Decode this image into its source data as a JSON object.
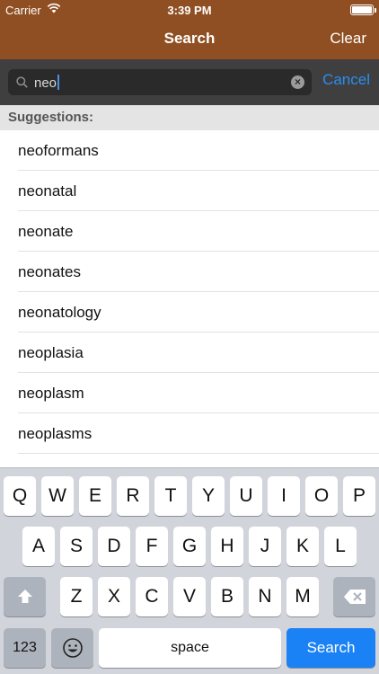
{
  "status_bar": {
    "carrier": "Carrier",
    "time": "3:39 PM"
  },
  "nav": {
    "title": "Search",
    "clear_label": "Clear"
  },
  "search": {
    "value": "neo",
    "cancel_label": "Cancel"
  },
  "suggestions": {
    "header": "Suggestions:",
    "items": [
      "neoformans",
      "neonatal",
      "neonate",
      "neonates",
      "neonatology",
      "neoplasia",
      "neoplasm",
      "neoplasms"
    ]
  },
  "keyboard": {
    "row1": [
      "Q",
      "W",
      "E",
      "R",
      "T",
      "Y",
      "U",
      "I",
      "O",
      "P"
    ],
    "row2": [
      "A",
      "S",
      "D",
      "F",
      "G",
      "H",
      "J",
      "K",
      "L"
    ],
    "row3": [
      "Z",
      "X",
      "C",
      "V",
      "B",
      "N",
      "M"
    ],
    "numbers_label": "123",
    "space_label": "space",
    "search_label": "Search"
  },
  "colors": {
    "nav_bar": "#8f4f22",
    "accent": "#2b8cf0",
    "search_key": "#1a82f5"
  }
}
